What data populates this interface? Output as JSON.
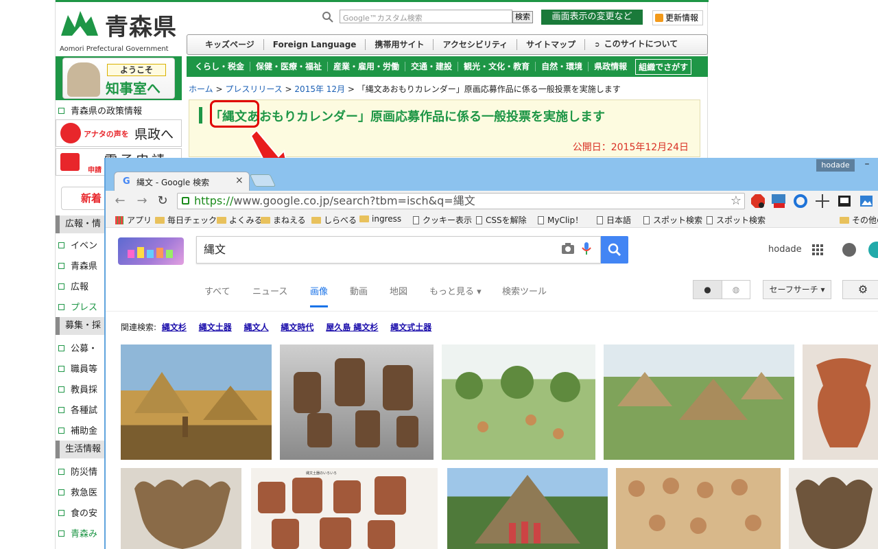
{
  "aomori": {
    "logo_name": "青森県",
    "logo_sub": "Aomori Prefectural Government",
    "search_placeholder": "Google™カスタム検索",
    "search_button": "検索",
    "display_button": "画面表示の変更など",
    "rss_button": "更新情報",
    "nav1": [
      "キッズページ",
      "Foreign Language",
      "携帯用サイト",
      "アクセシビリティ",
      "サイトマップ",
      "このサイトについて"
    ],
    "nav2": [
      "くらし・税金",
      "保健・医療・福祉",
      "産業・雇用・労働",
      "交通・建設",
      "観光・文化・教育",
      "自然・環境",
      "県政情報"
    ],
    "nav2_org": "組織でさがす",
    "governor_tag1": "ようこそ",
    "governor_tag2": "知事室へ",
    "side_policy": "青森県の政策情報",
    "anata_small": "アナタの声を",
    "anata_big": "県政へ",
    "denshi_title": "電子申請",
    "denshi_small": "申請",
    "shinchaku": "新着",
    "side_head1": "広報・情",
    "side_links1": [
      "イベン",
      "青森県",
      "広報",
      "プレス"
    ],
    "side_head2": "募集・採",
    "side_links2": [
      "公募・",
      "職員等",
      "教員採",
      "各種試",
      "補助金"
    ],
    "side_head3": "生活情報",
    "side_links3": [
      "防災情",
      "救急医",
      "食の安",
      "青森み"
    ],
    "breadcrumb": {
      "home": "ホーム",
      "press": "プレスリリース",
      "month": "2015年 12月",
      "current": "「縄文あおもりカレンダー」原画応募作品に係る一般投票を実施します"
    },
    "page_title": "「縄文あおもりカレンダー」原画応募作品に係る一般投票を実施します",
    "publish_date": "公開日：2015年12月24日"
  },
  "chrome": {
    "profile": "hodade",
    "minimize": "–",
    "tab_title": "縄文 - Google 検索",
    "url_https": "https://",
    "url_rest": "www.google.co.jp/search?tbm=isch&q=縄文",
    "bookmarks": [
      {
        "label": "アプリ",
        "type": "apps"
      },
      {
        "label": "毎日チェック",
        "type": "folder"
      },
      {
        "label": "よくみる",
        "type": "folder"
      },
      {
        "label": "まねえる",
        "type": "folder"
      },
      {
        "label": "しらべる",
        "type": "folder"
      },
      {
        "label": "ingress",
        "type": "folder"
      },
      {
        "label": "クッキー表示",
        "type": "page"
      },
      {
        "label": "CSSを解除",
        "type": "page"
      },
      {
        "label": "MyClip！",
        "type": "page"
      },
      {
        "label": "日本語",
        "type": "page"
      },
      {
        "label": "スポット検索",
        "type": "page"
      },
      {
        "label": "スポット検索",
        "type": "page"
      },
      {
        "label": "その他の",
        "type": "folder"
      }
    ]
  },
  "google": {
    "query": "縄文",
    "user": "hodade",
    "tabs": [
      "すべて",
      "ニュース",
      "画像",
      "動画",
      "地図",
      "もっと見る ▾",
      "検索ツール"
    ],
    "active_tab": "画像",
    "safesearch": "セーフサーチ ▾",
    "related_label": "関連検索:",
    "related": [
      "縄文杉",
      "縄文土器",
      "縄文人",
      "縄文時代",
      "屋久島 縄文杉",
      "縄文式土器"
    ],
    "image_caption_small": "縄文土器のいろいろ"
  },
  "colors": {
    "aomori_green": "#1e9646",
    "google_blue": "#4285f4",
    "alert_red": "#e00000"
  }
}
